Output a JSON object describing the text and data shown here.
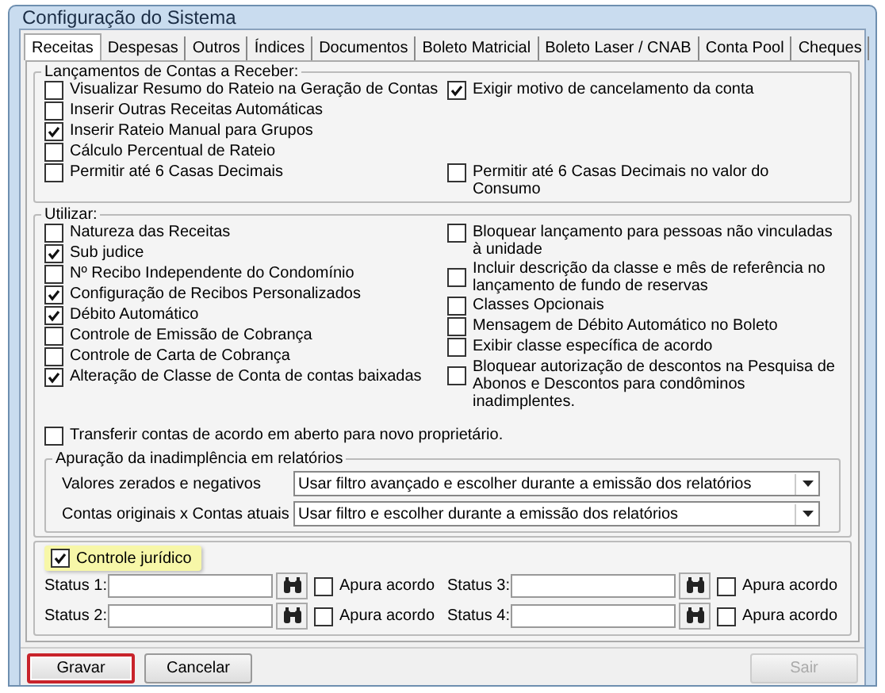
{
  "window": {
    "title": "Configuração do Sistema"
  },
  "tabs": [
    {
      "label": "Receitas",
      "selected": true
    },
    {
      "label": "Despesas",
      "selected": false
    },
    {
      "label": "Outros",
      "selected": false
    },
    {
      "label": "Índices",
      "selected": false
    },
    {
      "label": "Documentos",
      "selected": false
    },
    {
      "label": "Boleto Matricial",
      "selected": false
    },
    {
      "label": "Boleto Laser / CNAB",
      "selected": false
    },
    {
      "label": "Conta Pool",
      "selected": false
    },
    {
      "label": "Cheques",
      "selected": false
    }
  ],
  "lancamentos": {
    "title": "Lançamentos de Contas a Receber:",
    "rows": [
      {
        "items": [
          {
            "label": "Visualizar Resumo do Rateio na Geração de Contas",
            "checked": false
          },
          {
            "label": "Exigir motivo de cancelamento da conta",
            "checked": true
          }
        ]
      },
      {
        "items": [
          {
            "label": "Inserir Outras Receitas Automáticas",
            "checked": false
          }
        ]
      },
      {
        "items": [
          {
            "label": "Inserir Rateio Manual para Grupos",
            "checked": true
          }
        ]
      },
      {
        "items": [
          {
            "label": "Cálculo Percentual de Rateio",
            "checked": false
          }
        ]
      },
      {
        "items": [
          {
            "label": "Permitir até 6 Casas Decimais",
            "checked": false
          },
          {
            "label": "Permitir até 6 Casas Decimais no valor do Consumo",
            "checked": false
          }
        ]
      }
    ]
  },
  "utilizar": {
    "title": "Utilizar:",
    "left": [
      {
        "label": "Natureza das Receitas",
        "checked": false
      },
      {
        "label": "Sub judice",
        "checked": true
      },
      {
        "label": "Nº Recibo Independente do Condomínio",
        "checked": false
      },
      {
        "label": "Configuração de Recibos Personalizados",
        "checked": true
      },
      {
        "label": "Débito Automático",
        "checked": true
      },
      {
        "label": "Controle de Emissão de Cobrança",
        "checked": false
      },
      {
        "label": "Controle de Carta de Cobrança",
        "checked": false
      },
      {
        "label": "Alteração de Classe de Conta de contas baixadas",
        "checked": true
      }
    ],
    "right": [
      {
        "label": "Bloquear lançamento para pessoas não vinculadas à unidade",
        "checked": false
      },
      {
        "label": "Incluir descrição da classe e mês de referência no lançamento de fundo de reservas",
        "checked": false
      },
      {
        "label": "Classes Opcionais",
        "checked": false
      },
      {
        "label": "Mensagem de Débito Automático no Boleto",
        "checked": false
      },
      {
        "label": "Exibir classe específica de acordo",
        "checked": false
      },
      {
        "label": "Bloquear autorização de descontos na Pesquisa de Abonos e Descontos para condôminos inadimplentes.",
        "checked": false
      }
    ],
    "transfer": {
      "label": "Transferir contas de acordo em aberto para novo proprietário.",
      "checked": false
    },
    "apuracao": {
      "title": "Apuração da inadimplência em relatórios",
      "rows": [
        {
          "label": "Valores zerados e negativos",
          "value": "Usar filtro avançado e escolher durante a emissão dos relatórios"
        },
        {
          "label": "Contas originais x Contas atuais",
          "value": "Usar filtro e escolher durante a emissão dos relatórios"
        }
      ]
    }
  },
  "juridico": {
    "control": {
      "label": "Controle jurídico",
      "checked": true,
      "highlighted": true
    },
    "status": [
      {
        "label": "Status 1:",
        "apura": {
          "label": "Apura acordo",
          "checked": false
        }
      },
      {
        "label": "Status 3:",
        "apura": {
          "label": "Apura acordo",
          "checked": false
        }
      },
      {
        "label": "Status 2:",
        "apura": {
          "label": "Apura acordo",
          "checked": false
        }
      },
      {
        "label": "Status 4:",
        "apura": {
          "label": "Apura acordo",
          "checked": false
        }
      }
    ]
  },
  "buttons": [
    {
      "label": "Gravar",
      "highlighted": true,
      "disabled": false
    },
    {
      "label": "Cancelar",
      "highlighted": false,
      "disabled": false
    },
    {
      "label": "Sair",
      "highlighted": false,
      "disabled": true
    }
  ]
}
